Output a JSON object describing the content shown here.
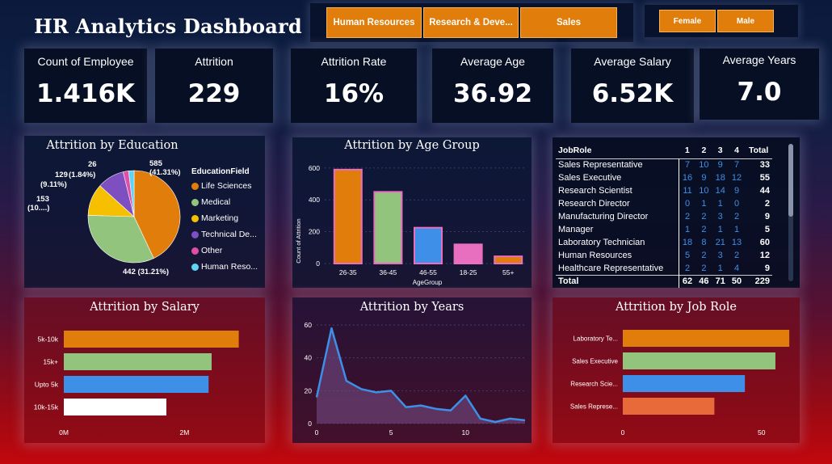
{
  "header": {
    "title": "HR Analytics Dashboard"
  },
  "department_slicer": [
    "Human Resources",
    "Research & Deve...",
    "Sales"
  ],
  "gender_slicer": [
    "Female",
    "Male"
  ],
  "kpis": [
    {
      "label": "Count of Employee",
      "value": "1.416K"
    },
    {
      "label": "Attrition",
      "value": "229"
    },
    {
      "label": "Attrition Rate",
      "value": "16%"
    },
    {
      "label": "Average Age",
      "value": "36.92"
    },
    {
      "label": "Average Salary",
      "value": "6.52K"
    },
    {
      "label": "Average Years",
      "value": "7.0"
    }
  ],
  "education": {
    "title": "Attrition by Education",
    "legend_title": "EducationField",
    "legend": [
      "Life Sciences",
      "Medical",
      "Marketing",
      "Technical De...",
      "Other",
      "Human Reso..."
    ],
    "labels": {
      "ls1": "585",
      "ls2": "(41.31%)",
      "med": "442 (31.21%)",
      "mkt1": "153",
      "mkt2": "(10....)",
      "tech1": "129",
      "tech2": "(9.11%)",
      "oth": "(1.84%)",
      "hr": "26"
    },
    "colors": [
      "#e07d0b",
      "#93c47d",
      "#f6c000",
      "#7e4fc0",
      "#e04fa6",
      "#5ed3f3"
    ],
    "chart_data": {
      "type": "pie",
      "categories": [
        "Life Sciences",
        "Medical",
        "Marketing",
        "Technical De...",
        "Other",
        "Human Reso..."
      ],
      "values": [
        585,
        442,
        153,
        129,
        26,
        26
      ]
    }
  },
  "age": {
    "title": "Attrition by Age Group",
    "ylabel": "Count of Attrition",
    "xlabel": "AgeGroup",
    "yticks": [
      "0",
      "200",
      "400",
      "600"
    ],
    "colors": [
      "#e07d0b",
      "#93c47d",
      "#3d8fe8",
      "#e86fc0",
      "#e07d0b"
    ],
    "chart_data": {
      "type": "bar",
      "categories": [
        "26-35",
        "36-45",
        "46-55",
        "18-25",
        "55+"
      ],
      "values": [
        590,
        450,
        225,
        120,
        45
      ],
      "ylim": [
        0,
        650
      ]
    }
  },
  "jobrole_table": {
    "headers": [
      "JobRole",
      "1",
      "2",
      "3",
      "4",
      "Total"
    ],
    "rows": [
      [
        "Sales Representative",
        "7",
        "10",
        "9",
        "7",
        "33"
      ],
      [
        "Sales Executive",
        "16",
        "9",
        "18",
        "12",
        "55"
      ],
      [
        "Research Scientist",
        "11",
        "10",
        "14",
        "9",
        "44"
      ],
      [
        "Research Director",
        "0",
        "1",
        "1",
        "0",
        "2"
      ],
      [
        "Manufacturing Director",
        "2",
        "2",
        "3",
        "2",
        "9"
      ],
      [
        "Manager",
        "1",
        "2",
        "1",
        "1",
        "5"
      ],
      [
        "Laboratory Technician",
        "18",
        "8",
        "21",
        "13",
        "60"
      ],
      [
        "Human Resources",
        "5",
        "2",
        "3",
        "2",
        "12"
      ],
      [
        "Healthcare Representative",
        "2",
        "2",
        "1",
        "4",
        "9"
      ]
    ],
    "total": [
      "Total",
      "62",
      "46",
      "71",
      "50",
      "229"
    ]
  },
  "salary": {
    "title": "Attrition by Salary",
    "xticks": [
      "0M",
      "2M"
    ],
    "colors": [
      "#e07d0b",
      "#93c47d",
      "#3d8fe8",
      "#ffffff"
    ],
    "chart_data": {
      "type": "bar",
      "categories": [
        "5k-10k",
        "15k+",
        "Upto 5k",
        "10k-15k"
      ],
      "values": [
        2.9,
        2.45,
        2.4,
        1.7
      ],
      "xlim": [
        0,
        3.2
      ]
    }
  },
  "years": {
    "title": "Attrition by Years",
    "yticks": [
      "0",
      "20",
      "40",
      "60"
    ],
    "xticks": [
      "0",
      "5",
      "10"
    ],
    "color": "#3d8fe8",
    "chart_data": {
      "type": "area",
      "x": [
        0,
        1,
        2,
        3,
        4,
        5,
        6,
        7,
        8,
        9,
        10,
        11,
        12,
        13,
        14
      ],
      "y": [
        16,
        58,
        26,
        21,
        19,
        20,
        10,
        11,
        9,
        8,
        17,
        3,
        1,
        3,
        2
      ],
      "ylim": [
        0,
        62
      ]
    }
  },
  "jobrole_chart": {
    "title": "Attrition by Job Role",
    "xticks": [
      "0",
      "50"
    ],
    "colors": [
      "#e07d0b",
      "#93c47d",
      "#3d8fe8",
      "#e86a3a"
    ],
    "chart_data": {
      "type": "bar",
      "categories": [
        "Laboratory Te...",
        "Sales Executive",
        "Research Scie...",
        "Sales Represe..."
      ],
      "values": [
        60,
        55,
        44,
        33
      ],
      "xlim": [
        0,
        62
      ]
    }
  }
}
